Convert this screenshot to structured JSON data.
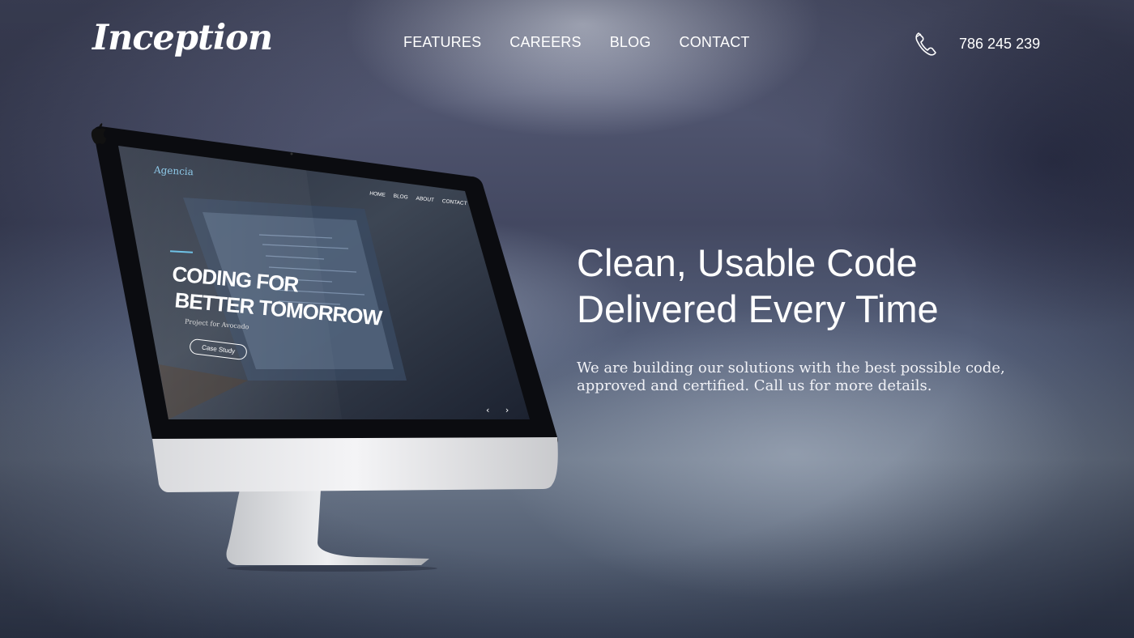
{
  "header": {
    "logo": "Inception",
    "nav": [
      "FEATURES",
      "CAREERS",
      "BLOG",
      "CONTACT"
    ],
    "phone_icon": "phone-icon",
    "phone_number": "786 245 239"
  },
  "hero": {
    "title_lines": [
      "Clean, Usable Code",
      "Delivered Every Time"
    ],
    "text_lines": [
      "We are building our solutions with the best possible code,",
      "approved and certified. Call us for more details."
    ]
  },
  "mockup": {
    "brand": "Agencia",
    "nav": [
      "HOME",
      "BLOG",
      "ABOUT",
      "CONTACT"
    ],
    "headline_lines": [
      "CODING FOR",
      "BETTER TOMORROW"
    ],
    "subtitle": "Project for Avocado",
    "cta": "Case Study",
    "slider_arrows": "‹ ›",
    "logo_icon": "apple-icon"
  },
  "colors": {
    "accent": "#6fc2e6",
    "text": "#ffffff",
    "background_base": "#4a4f68"
  }
}
